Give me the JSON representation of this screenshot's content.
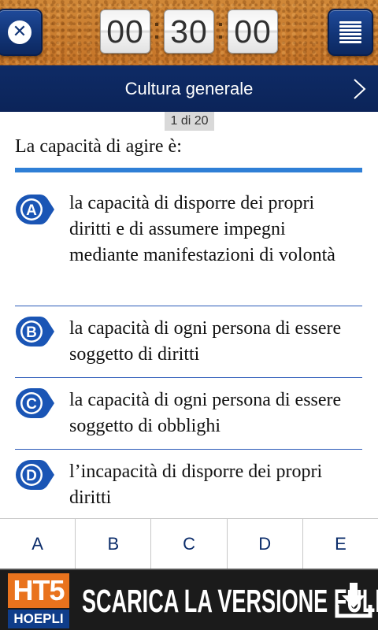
{
  "header": {
    "close_icon": "close-icon",
    "menu_icon": "list-menu-icon",
    "timer": {
      "hours": "00",
      "minutes": "30",
      "seconds": "00"
    }
  },
  "category": {
    "title": "Cultura generale",
    "next_icon": "chevron-right-icon"
  },
  "question": {
    "counter": "1 di 20",
    "text": "La capacità di agire è:"
  },
  "answers": [
    {
      "letter": "A",
      "text": "la capacità di disporre dei propri diritti e di assumere impegni mediante manifestazioni di volontà"
    },
    {
      "letter": "B",
      "text": "la capacità di ogni persona di essere soggetto di diritti"
    },
    {
      "letter": "C",
      "text": "la capacità di ogni persona di essere soggetto di obblighi"
    },
    {
      "letter": "D",
      "text": "l’incapacità di disporre dei propri diritti"
    }
  ],
  "answer_buttons": [
    "A",
    "B",
    "C",
    "D",
    "E"
  ],
  "banner": {
    "logo_top": "HT5",
    "logo_bottom": "HOEPLI",
    "text": "SCARICA LA VERSIONE FULL!",
    "download_icon": "download-icon"
  },
  "colors": {
    "navy": "#0c2459",
    "accent_blue": "#2f7fd6",
    "cork": "#c87a2e",
    "logo_orange": "#e9731d"
  }
}
